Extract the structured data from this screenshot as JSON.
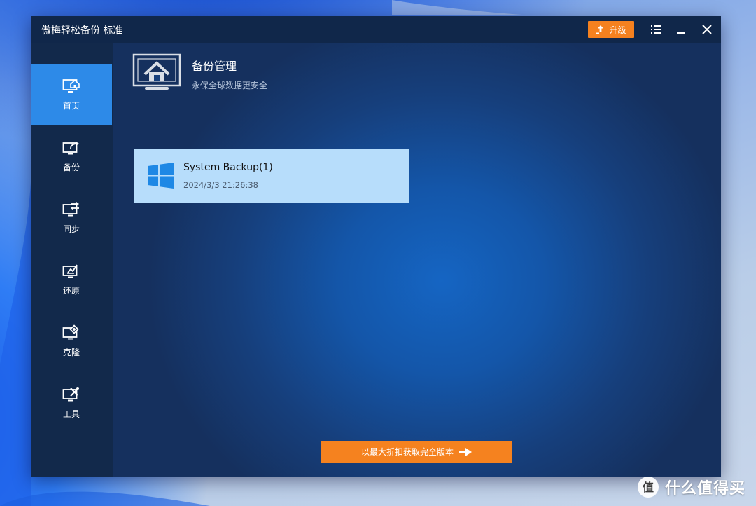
{
  "window": {
    "title": "傲梅轻松备份 标准",
    "upgrade_label": "升级"
  },
  "sidebar": {
    "items": [
      {
        "label": "首页",
        "icon": "home-monitor-icon",
        "active": true
      },
      {
        "label": "备份",
        "icon": "backup-monitor-icon",
        "active": false
      },
      {
        "label": "同步",
        "icon": "sync-monitor-icon",
        "active": false
      },
      {
        "label": "还原",
        "icon": "restore-monitor-icon",
        "active": false
      },
      {
        "label": "克隆",
        "icon": "clone-monitor-icon",
        "active": false
      },
      {
        "label": "工具",
        "icon": "tools-monitor-icon",
        "active": false
      }
    ]
  },
  "main": {
    "title": "备份管理",
    "subtitle": "永保全球数据更安全",
    "tasks": [
      {
        "name": "System Backup(1)",
        "date": "2024/3/3 21:26:38",
        "icon": "windows-logo-icon"
      }
    ],
    "promo_label": "以最大折扣获取完全版本"
  },
  "watermark": {
    "text": "什么值得买",
    "logo_char": "值"
  },
  "colors": {
    "accent_orange": "#f5811f",
    "nav_active": "#2d8ae8",
    "sidebar_bg": "#12294b",
    "card_bg": "#b7ddfb",
    "windows_blue": "#1e88e5"
  }
}
